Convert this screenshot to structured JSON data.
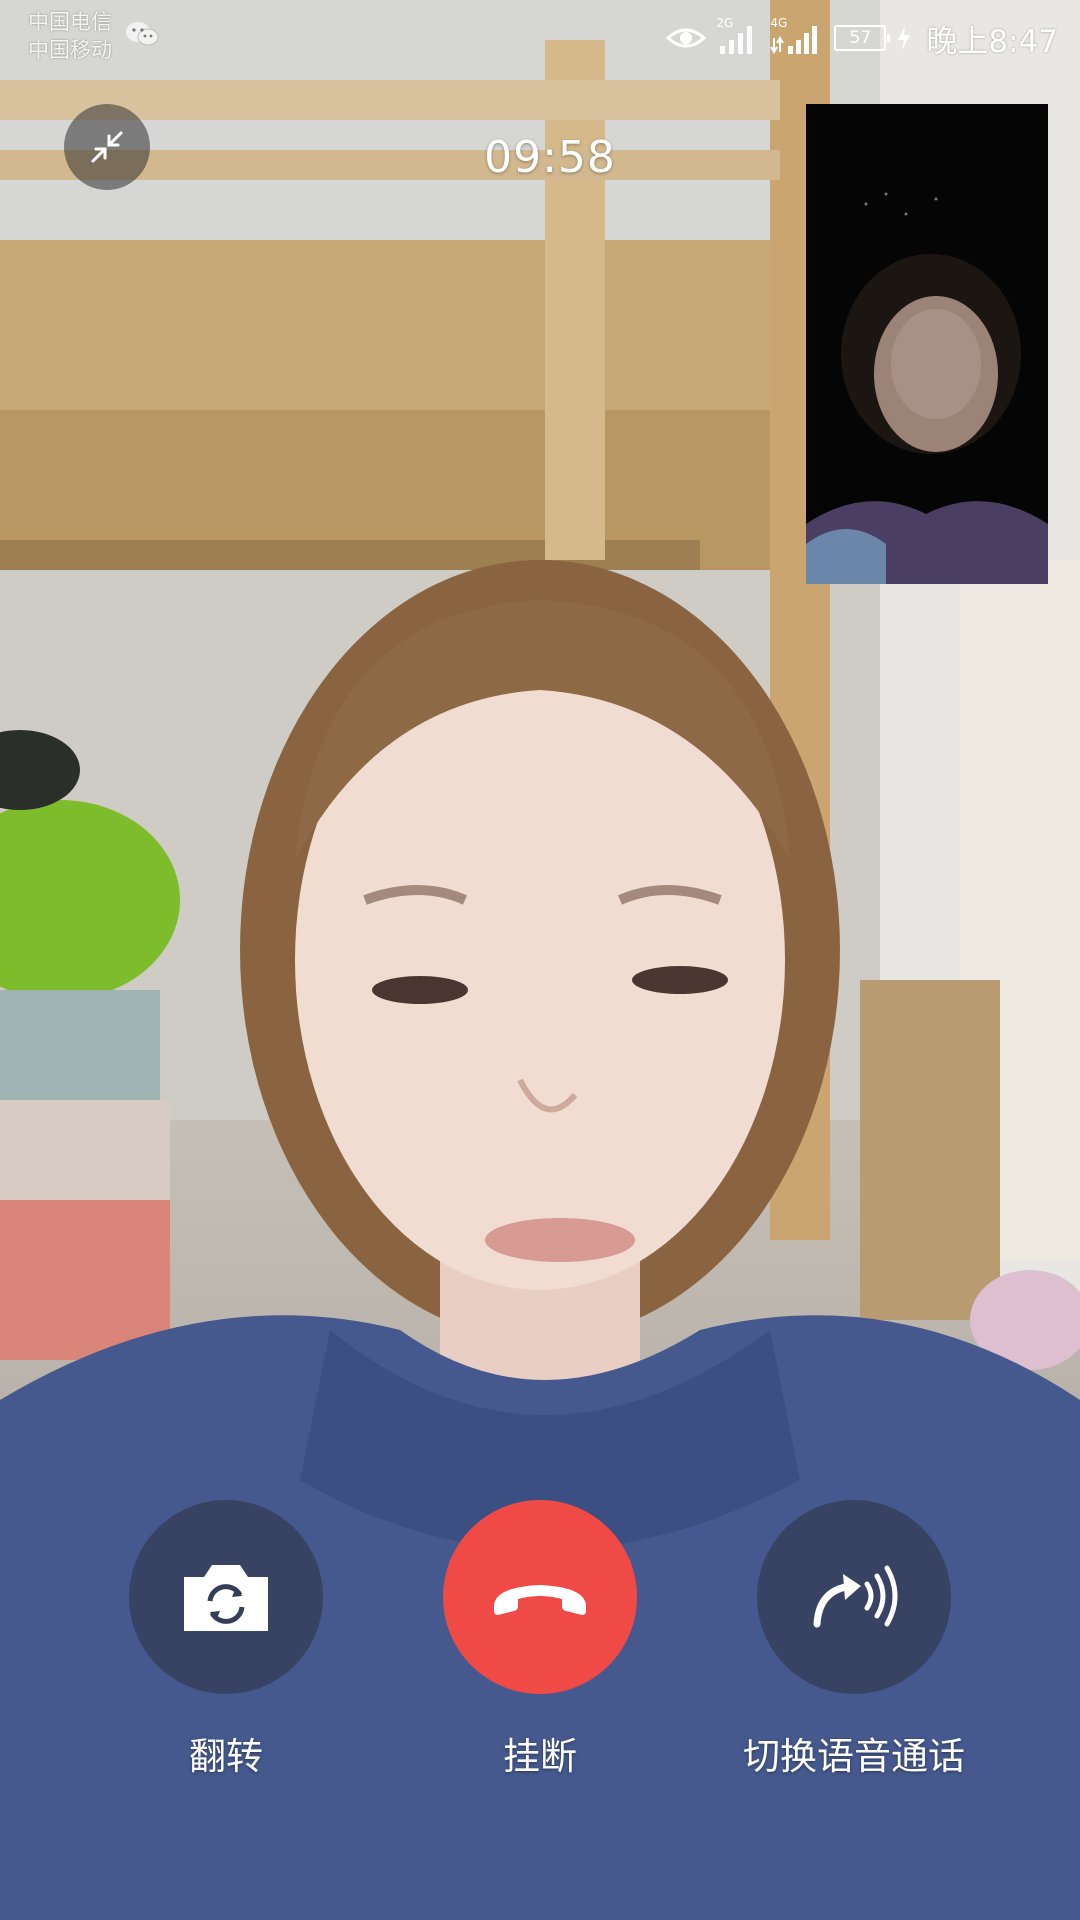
{
  "status_bar": {
    "carrier_1": "中国电信",
    "carrier_2": "中国移动",
    "network_1": "2G",
    "network_2": "4G",
    "battery_level": "57",
    "time": "晚上8:47"
  },
  "call": {
    "duration": "09:58"
  },
  "controls": {
    "flip_label": "翻转",
    "hangup_label": "挂断",
    "switch_voice_label": "切换语音通话"
  },
  "colors": {
    "hangup_red": "#f04a47",
    "control_dark": "#343e58"
  }
}
